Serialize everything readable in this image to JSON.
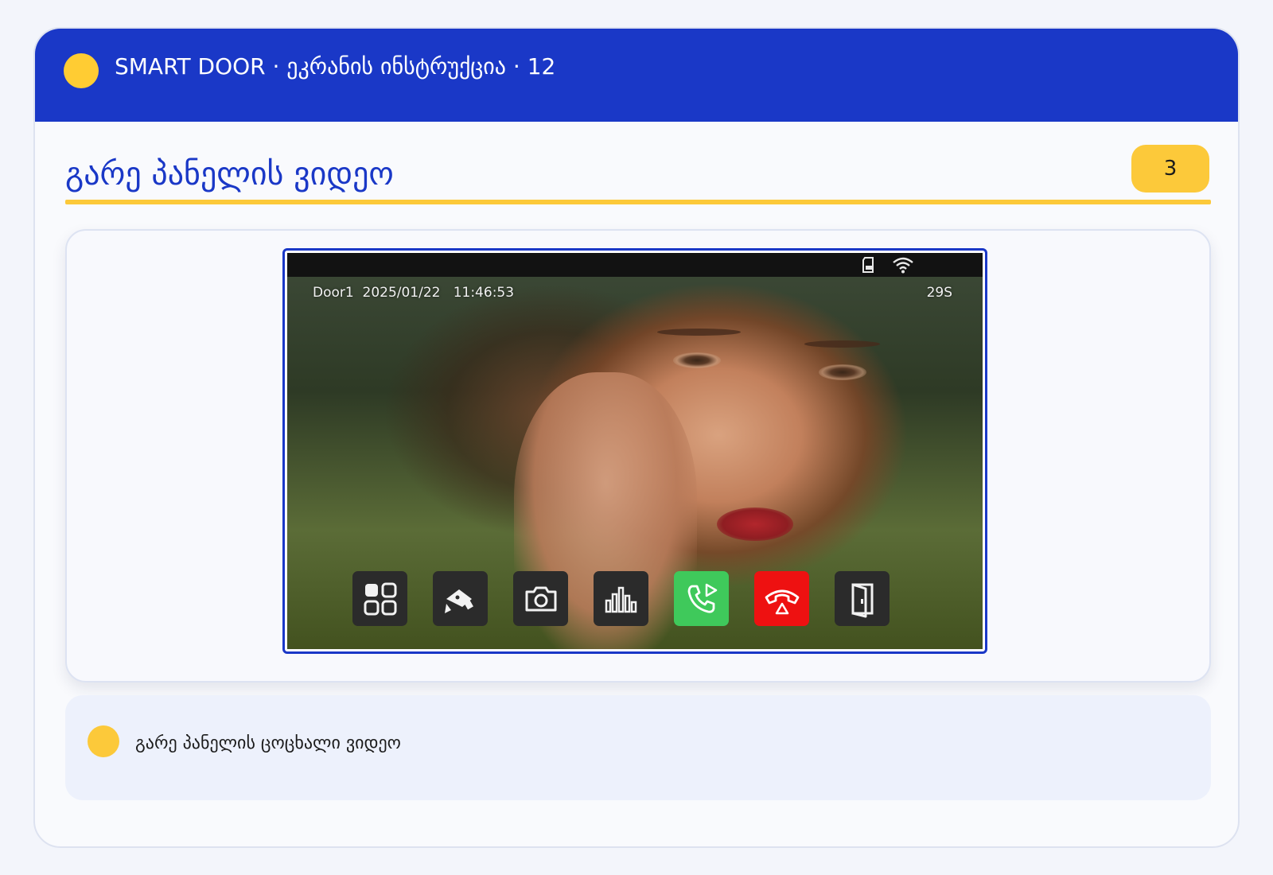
{
  "header": {
    "title": "SMART DOOR · ეკრანის ინსტრუქცია · 12"
  },
  "section": {
    "title": "გარე პანელის ვიდეო",
    "page_badge": "3"
  },
  "screen": {
    "osd_label": "Door1  2025/01/22   11:46:53",
    "timer": "29S",
    "status_icons": [
      "sd-card-icon",
      "wifi-icon"
    ],
    "controls": [
      {
        "name": "menu-button",
        "icon": "grid-icon"
      },
      {
        "name": "camera-switch-button",
        "icon": "cctv-camera-icon"
      },
      {
        "name": "snapshot-button",
        "icon": "camera-icon"
      },
      {
        "name": "volume-button",
        "icon": "volume-bars-icon"
      },
      {
        "name": "answer-button",
        "icon": "phone-answer-icon",
        "color": "#3fc95b"
      },
      {
        "name": "hangup-button",
        "icon": "phone-hangup-icon",
        "color": "#ee1111"
      },
      {
        "name": "unlock-door-button",
        "icon": "door-icon"
      }
    ]
  },
  "note": {
    "text": "გარე პანელის ცოცხალი ვიდეო"
  },
  "colors": {
    "primary": "#1a38c7",
    "accent": "#fcc93a",
    "answer": "#3fc95b",
    "hangup": "#ee1111"
  }
}
